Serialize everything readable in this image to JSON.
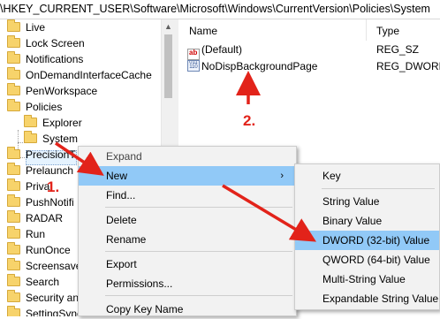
{
  "address_bar": {
    "path": "\\HKEY_CURRENT_USER\\Software\\Microsoft\\Windows\\CurrentVersion\\Policies\\System"
  },
  "tree": {
    "items": [
      {
        "label": "Live",
        "indent": 0
      },
      {
        "label": "Lock Screen",
        "indent": 0
      },
      {
        "label": "Notifications",
        "indent": 0
      },
      {
        "label": "OnDemandInterfaceCache",
        "indent": 0
      },
      {
        "label": "PenWorkspace",
        "indent": 0
      },
      {
        "label": "Policies",
        "indent": 0
      },
      {
        "label": "Explorer",
        "indent": 1
      },
      {
        "label": "System",
        "indent": 1,
        "selected": true
      },
      {
        "label": "PrecisionT",
        "indent": 0
      },
      {
        "label": "Prelaunch",
        "indent": 0
      },
      {
        "label": "Priva",
        "indent": 0
      },
      {
        "label": "PushNotifi",
        "indent": 0
      },
      {
        "label": "RADAR",
        "indent": 0
      },
      {
        "label": "Run",
        "indent": 0
      },
      {
        "label": "RunOnce",
        "indent": 0
      },
      {
        "label": "Screensave",
        "indent": 0
      },
      {
        "label": "Search",
        "indent": 0
      },
      {
        "label": "Security and",
        "indent": 0
      },
      {
        "label": "SettingSync",
        "indent": 0
      }
    ]
  },
  "values_pane": {
    "columns": {
      "name": "Name",
      "type": "Type"
    },
    "rows": [
      {
        "icon": "string-value-icon",
        "name": "(Default)",
        "type": "REG_SZ"
      },
      {
        "icon": "binary-value-icon",
        "name": "NoDispBackgroundPage",
        "type": "REG_DWORD"
      }
    ]
  },
  "context_menu": {
    "items": [
      "Expand",
      "New",
      "Find...",
      "Delete",
      "Rename",
      "Export",
      "Permissions...",
      "Copy Key Name"
    ],
    "highlighted": "New"
  },
  "submenu": {
    "items": [
      "Key",
      "String Value",
      "Binary Value",
      "DWORD (32-bit) Value",
      "QWORD (64-bit) Value",
      "Multi-String Value",
      "Expandable String Value"
    ],
    "highlighted": "DWORD (32-bit) Value"
  },
  "annotations": {
    "step1": "1.",
    "step2": "2."
  },
  "colors": {
    "highlight": "#91c9f7",
    "annotation_red": "#e2231a",
    "selection": "#e5f3ff"
  }
}
